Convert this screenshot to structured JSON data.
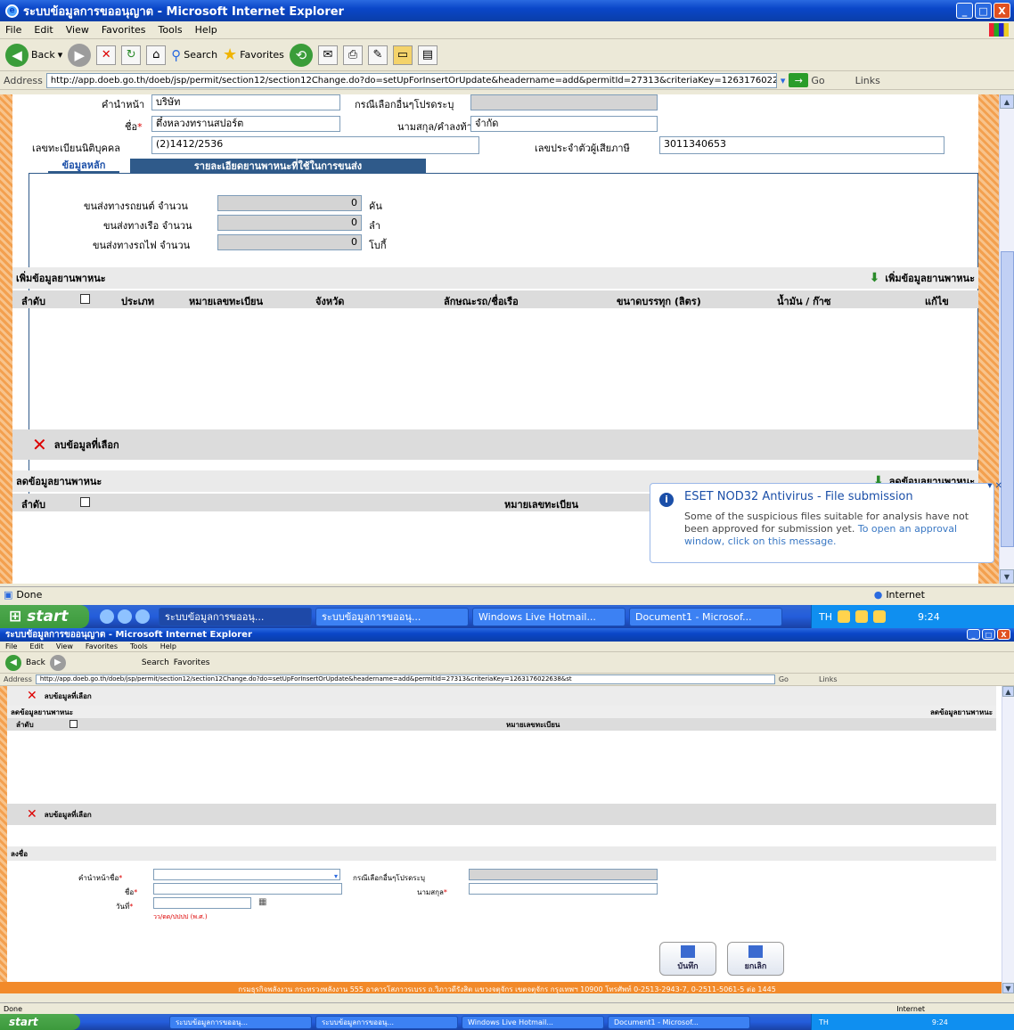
{
  "window": {
    "title": "ระบบข้อมูลการขออนุญาต - Microsoft Internet Explorer",
    "minimize": "_",
    "maximize": "□",
    "close": "X"
  },
  "menu": [
    "File",
    "Edit",
    "View",
    "Favorites",
    "Tools",
    "Help"
  ],
  "toolbar": {
    "back_label": "Back",
    "search_label": "Search",
    "favorites_label": "Favorites"
  },
  "address": {
    "label": "Address",
    "url": "http://app.doeb.go.th/doeb/jsp/permit/section12/section12Change.do?do=setUpForInsertOrUpdate&headername=add&permitId=27313&criteriaKey=1263176022638&st",
    "go_label": "Go",
    "links_label": "Links"
  },
  "form": {
    "prefix_label": "คำนำหน้า",
    "prefix_value": "บริษัท",
    "other_label": "กรณีเลือกอื่นๆโปรดระบุ",
    "name_label": "ชื่อ",
    "name_value": "ตึ๋งหลวงทรานสปอร์ต",
    "surname_label": "นามสกุล/คำลงท้าย",
    "surname_value": "จำกัด",
    "reg_label": "เลขทะเบียนนิติบุคคล",
    "reg_value": "(2)1412/2536",
    "tax_label": "เลขประจำตัวผู้เสียภาษี",
    "tax_value": "3011340653"
  },
  "tabs": {
    "main": "ข้อมูลหลัก",
    "vehicles": "รายละเอียดยานพาหนะที่ใช้ในการขนส่ง"
  },
  "transport": {
    "car_label": "ขนส่งทางรถยนต์ จำนวน",
    "car_value": "0",
    "car_unit": "คัน",
    "boat_label": "ขนส่งทางเรือ จำนวน",
    "boat_value": "0",
    "boat_unit": "ลำ",
    "train_label": "ขนส่งทางรถไฟ จำนวน",
    "train_value": "0",
    "train_unit": "โบกี้"
  },
  "add_section": {
    "title": "เพิ่มข้อมูลยานพาหนะ",
    "add_button": "เพิ่มข้อมูลยานพาหนะ",
    "columns": [
      "ลำดับ",
      "ประเภท",
      "หมายเลขทะเบียน",
      "จังหวัด",
      "ลักษณะรถ/ชื่อเรือ",
      "ขนาดบรรทุก (ลิตร)",
      "น้ำมัน / ก๊าซ",
      "แก้ไข"
    ],
    "delete_label": "ลบข้อมูลที่เลือก"
  },
  "reduce_section": {
    "title": "ลดข้อมูลยานพาหนะ",
    "reduce_button": "ลดข้อมูลยานพาหนะ",
    "columns": [
      "ลำดับ",
      "หมายเลขทะเบียน"
    ],
    "delete_label": "ลบข้อมูลที่เลือก"
  },
  "balloon": {
    "title": "ESET NOD32 Antivirus - File submission",
    "body": "Some of the suspicious files suitable for analysis have not been approved for submission yet.",
    "link": "To open an approval window, click on this message."
  },
  "status": {
    "text": "Done",
    "zone": "Internet"
  },
  "taskbar": {
    "start": "start",
    "items": [
      "ระบบข้อมูลการขออนุ...",
      "ระบบข้อมูลการขออนุ...",
      "Windows Live Hotmail...",
      "Document1 - Microsof..."
    ],
    "lang": "TH",
    "time": "9:24"
  },
  "sign_section": {
    "title": "ลงชื่อ",
    "prefix_label": "คำนำหน้าชื่อ",
    "other_label": "กรณีเลือกอื่นๆโปรดระบุ",
    "name_label": "ชื่อ",
    "surname_label": "นามสกุล",
    "date_label": "วันที่",
    "date_hint": "วว/ดด/ปปปป (พ.ศ.)",
    "save_button": "บันทึก",
    "cancel_button": "ยกเลิก"
  },
  "footer": "กรมธุรกิจพลังงาน กระทรวงพลังงาน 555 อาคารโสภาวรเบรร ถ.วิภาวดีรังสิต แขวงจตุจักร เขตจตุจักร กรุงเทพฯ 10900 โทรศัพท์ 0-2513-2943-7, 0-2511-5061-5 ต่อ 1445"
}
